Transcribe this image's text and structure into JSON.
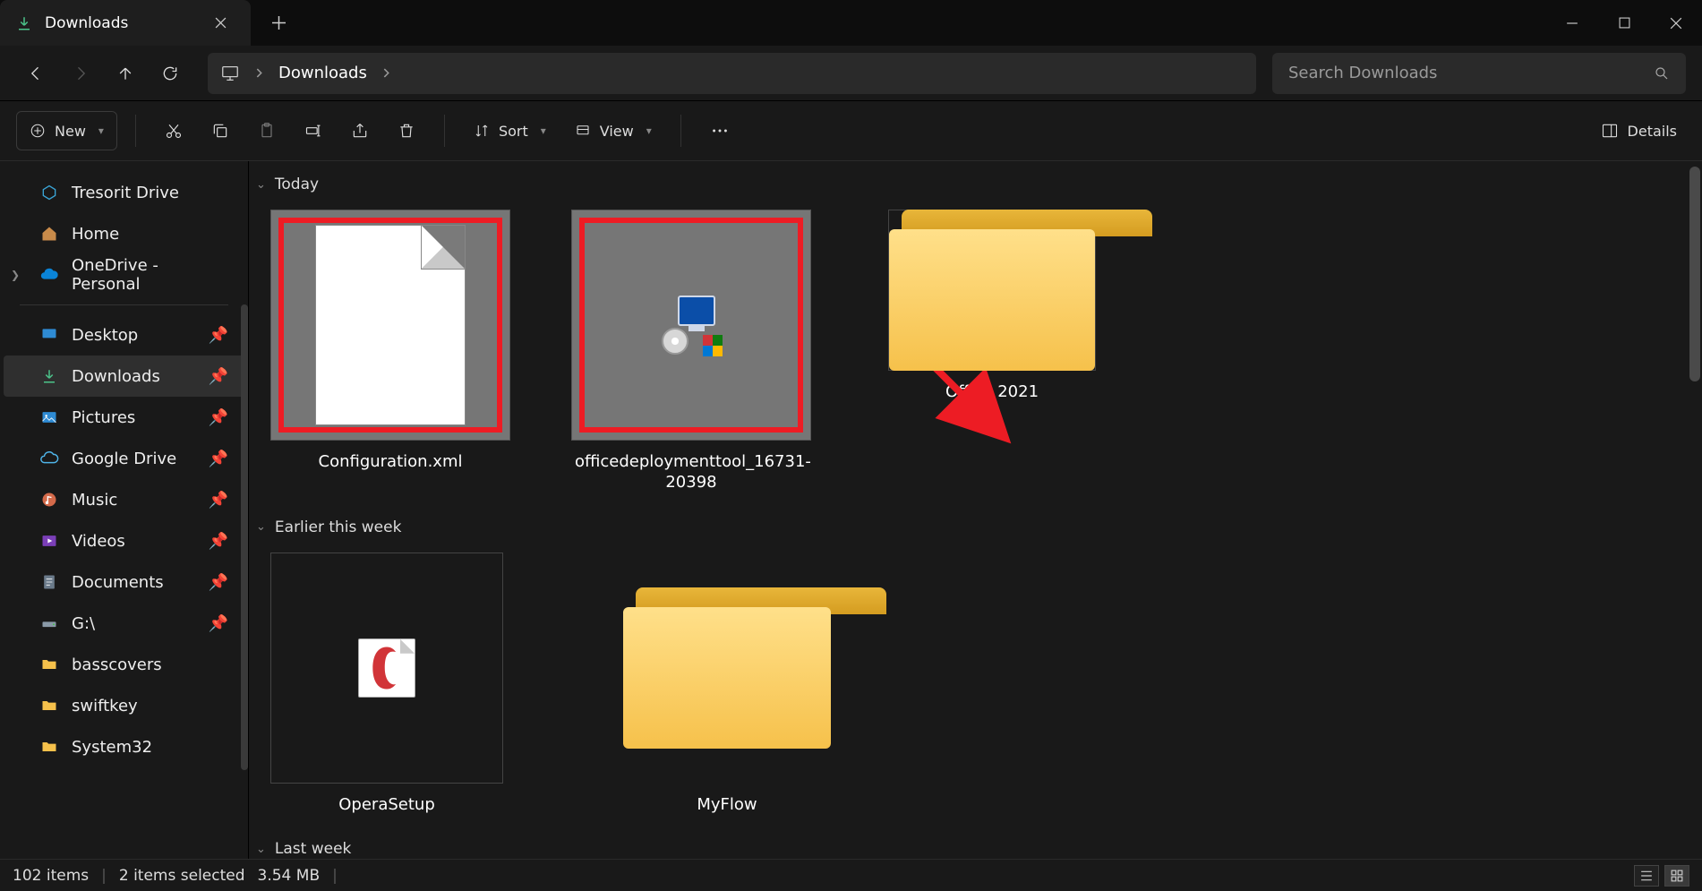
{
  "window": {
    "tab_title": "Downloads"
  },
  "address": {
    "location": "Downloads"
  },
  "search": {
    "placeholder": "Search Downloads"
  },
  "toolbar": {
    "new_label": "New",
    "sort_label": "Sort",
    "view_label": "View",
    "details_label": "Details"
  },
  "sidebar": {
    "top": [
      {
        "label": "Tresorit Drive",
        "icon": "tresorit"
      },
      {
        "label": "Home",
        "icon": "home"
      },
      {
        "label": "OneDrive - Personal",
        "icon": "onedrive",
        "expandable": true
      }
    ],
    "pinned": [
      {
        "label": "Desktop",
        "icon": "desktop"
      },
      {
        "label": "Downloads",
        "icon": "download",
        "active": true
      },
      {
        "label": "Pictures",
        "icon": "pictures"
      },
      {
        "label": "Google Drive",
        "icon": "gdrive"
      },
      {
        "label": "Music",
        "icon": "music"
      },
      {
        "label": "Videos",
        "icon": "videos"
      },
      {
        "label": "Documents",
        "icon": "documents"
      },
      {
        "label": "G:\\",
        "icon": "drive"
      }
    ],
    "folders": [
      {
        "label": "basscovers"
      },
      {
        "label": "swiftkey"
      },
      {
        "label": "System32"
      }
    ]
  },
  "groups": [
    {
      "title": "Today",
      "items": [
        {
          "name": "Configuration.xml",
          "kind": "xml",
          "selected": true,
          "highlighted": true
        },
        {
          "name": "officedeploymenttool_16731-20398",
          "kind": "exe",
          "selected": true,
          "highlighted": true
        },
        {
          "name": "Office 2021",
          "kind": "folder",
          "annotated_arrow": true
        }
      ]
    },
    {
      "title": "Earlier this week",
      "items": [
        {
          "name": "OperaSetup",
          "kind": "opera"
        },
        {
          "name": "MyFlow",
          "kind": "folder"
        }
      ]
    },
    {
      "title": "Last week",
      "items": []
    }
  ],
  "status": {
    "item_count": "102 items",
    "selection": "2 items selected",
    "size": "3.54 MB"
  }
}
